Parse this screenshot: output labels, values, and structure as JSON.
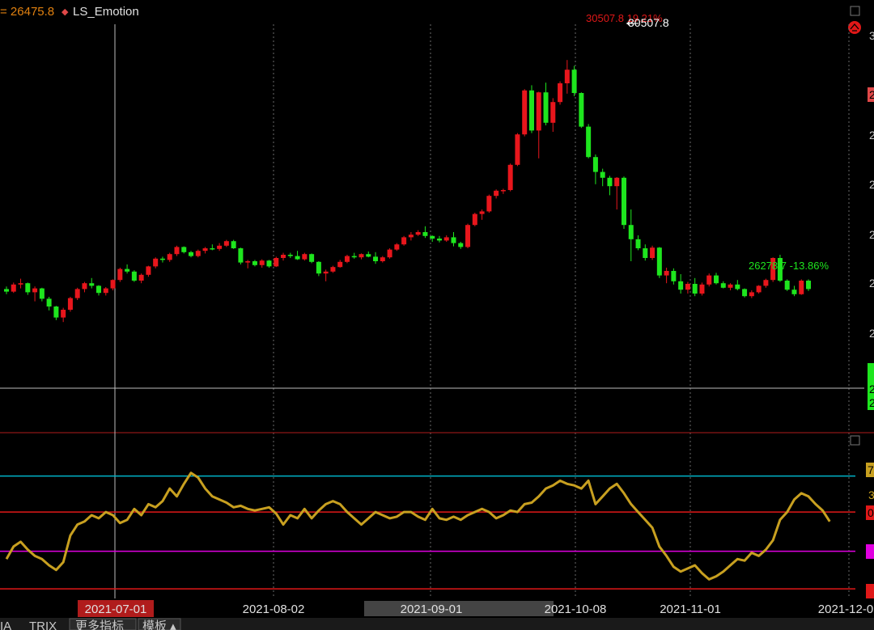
{
  "header": {
    "price_text": "= 26475.8",
    "indicator_marker": "◆",
    "indicator_name": "LS_Emotion"
  },
  "chart_data": [
    {
      "type": "candlestick",
      "y_range": [
        25500,
        31000
      ],
      "x_labels": [
        "2021-07-01",
        "2021-08-02",
        "2021-09-01",
        "2021-10-08",
        "2021-11-01",
        "2021-12-0"
      ],
      "max_annotation": "30507.8 19.21%",
      "max_pointer_label": "30507.8",
      "min_annotation": "26278.7 -13.86%",
      "right_axis_labels": [
        "3",
        "2",
        "2",
        "2",
        "2",
        "2",
        "2",
        "2",
        "2"
      ],
      "candles": [
        [
          26970,
          27010,
          26890,
          26930
        ],
        [
          26930,
          27070,
          26910,
          27040
        ],
        [
          27040,
          27130,
          26980,
          27060
        ],
        [
          27060,
          27070,
          26880,
          26920
        ],
        [
          26920,
          27010,
          26780,
          26980
        ],
        [
          26980,
          26990,
          26780,
          26820
        ],
        [
          26820,
          26850,
          26640,
          26700
        ],
        [
          26700,
          26710,
          26490,
          26530
        ],
        [
          26530,
          26680,
          26460,
          26650
        ],
        [
          26650,
          26850,
          26620,
          26830
        ],
        [
          26830,
          26990,
          26800,
          26970
        ],
        [
          26970,
          27080,
          26920,
          27060
        ],
        [
          27060,
          27140,
          26980,
          27020
        ],
        [
          27020,
          27030,
          26870,
          26910
        ],
        [
          26910,
          27000,
          26870,
          26980
        ],
        [
          26980,
          27120,
          26950,
          27110
        ],
        [
          27110,
          27300,
          27080,
          27280
        ],
        [
          27280,
          27350,
          27210,
          27240
        ],
        [
          27240,
          27260,
          27080,
          27100
        ],
        [
          27100,
          27210,
          27060,
          27190
        ],
        [
          27190,
          27330,
          27160,
          27320
        ],
        [
          27320,
          27460,
          27290,
          27440
        ],
        [
          27440,
          27470,
          27380,
          27420
        ],
        [
          27420,
          27530,
          27390,
          27510
        ],
        [
          27510,
          27640,
          27480,
          27620
        ],
        [
          27620,
          27630,
          27520,
          27540
        ],
        [
          27540,
          27560,
          27460,
          27480
        ],
        [
          27480,
          27580,
          27460,
          27560
        ],
        [
          27560,
          27620,
          27520,
          27600
        ],
        [
          27600,
          27660,
          27570,
          27590
        ],
        [
          27590,
          27680,
          27560,
          27640
        ],
        [
          27640,
          27730,
          27620,
          27710
        ],
        [
          27710,
          27730,
          27590,
          27600
        ],
        [
          27600,
          27610,
          27350,
          27380
        ],
        [
          27380,
          27420,
          27290,
          27400
        ],
        [
          27400,
          27420,
          27320,
          27340
        ],
        [
          27340,
          27430,
          27300,
          27410
        ],
        [
          27410,
          27420,
          27300,
          27320
        ],
        [
          27320,
          27470,
          27310,
          27450
        ],
        [
          27450,
          27530,
          27410,
          27500
        ],
        [
          27500,
          27530,
          27450,
          27480
        ],
        [
          27480,
          27560,
          27420,
          27430
        ],
        [
          27430,
          27530,
          27410,
          27510
        ],
        [
          27510,
          27520,
          27370,
          27390
        ],
        [
          27390,
          27400,
          27170,
          27210
        ],
        [
          27210,
          27270,
          27090,
          27240
        ],
        [
          27240,
          27330,
          27220,
          27310
        ],
        [
          27310,
          27420,
          27300,
          27390
        ],
        [
          27390,
          27500,
          27370,
          27480
        ],
        [
          27480,
          27530,
          27440,
          27460
        ],
        [
          27460,
          27520,
          27430,
          27510
        ],
        [
          27510,
          27550,
          27460,
          27470
        ],
        [
          27470,
          27540,
          27360,
          27400
        ],
        [
          27400,
          27480,
          27380,
          27460
        ],
        [
          27460,
          27600,
          27440,
          27580
        ],
        [
          27580,
          27680,
          27560,
          27660
        ],
        [
          27660,
          27790,
          27640,
          27770
        ],
        [
          27770,
          27850,
          27720,
          27810
        ],
        [
          27810,
          27880,
          27790,
          27850
        ],
        [
          27850,
          27940,
          27760,
          27790
        ],
        [
          27790,
          27800,
          27700,
          27750
        ],
        [
          27750,
          27790,
          27690,
          27720
        ],
        [
          27720,
          27800,
          27700,
          27770
        ],
        [
          27770,
          27850,
          27630,
          27680
        ],
        [
          27680,
          27700,
          27590,
          27620
        ],
        [
          27620,
          27980,
          27600,
          27960
        ],
        [
          27960,
          28150,
          27940,
          28130
        ],
        [
          28130,
          28200,
          28040,
          28170
        ],
        [
          28170,
          28430,
          28150,
          28410
        ],
        [
          28410,
          28510,
          28370,
          28490
        ],
        [
          28490,
          28520,
          28440,
          28500
        ],
        [
          28500,
          28910,
          28480,
          28890
        ],
        [
          28890,
          29380,
          28870,
          29360
        ],
        [
          29360,
          30060,
          29330,
          30040
        ],
        [
          30040,
          30120,
          29380,
          29420
        ],
        [
          29420,
          30020,
          28990,
          30010
        ],
        [
          30010,
          30160,
          29500,
          29540
        ],
        [
          29540,
          29920,
          29400,
          29860
        ],
        [
          29860,
          30180,
          29820,
          30150
        ],
        [
          30150,
          30510,
          29990,
          30360
        ],
        [
          30360,
          30420,
          29950,
          30000
        ],
        [
          30000,
          30010,
          29460,
          29480
        ],
        [
          29480,
          29520,
          28990,
          29010
        ],
        [
          29010,
          29050,
          28590,
          28780
        ],
        [
          28780,
          28830,
          28560,
          28690
        ],
        [
          28690,
          28720,
          28420,
          28560
        ],
        [
          28560,
          28700,
          28200,
          28690
        ],
        [
          28690,
          28710,
          27900,
          27960
        ],
        [
          27960,
          28200,
          27400,
          27740
        ],
        [
          27740,
          27800,
          27570,
          27600
        ],
        [
          27600,
          27660,
          27410,
          27450
        ],
        [
          27450,
          27640,
          27420,
          27610
        ],
        [
          27610,
          27620,
          27140,
          27180
        ],
        [
          27180,
          27300,
          27060,
          27250
        ],
        [
          27250,
          27290,
          27040,
          27090
        ],
        [
          27090,
          27200,
          26900,
          26960
        ],
        [
          26960,
          27080,
          26900,
          27050
        ],
        [
          27050,
          27140,
          26860,
          26900
        ],
        [
          26900,
          27070,
          26870,
          27040
        ],
        [
          27040,
          27210,
          27010,
          27180
        ],
        [
          27180,
          27220,
          27040,
          27060
        ],
        [
          27060,
          27090,
          26980,
          26990
        ],
        [
          26990,
          27060,
          26950,
          27040
        ],
        [
          27040,
          27110,
          26950,
          26970
        ],
        [
          26970,
          26980,
          26840,
          26860
        ],
        [
          26860,
          26950,
          26830,
          26920
        ],
        [
          26920,
          27030,
          26900,
          27020
        ],
        [
          27020,
          27130,
          26990,
          27110
        ],
        [
          27110,
          27460,
          27080,
          27450
        ],
        [
          27450,
          27500,
          27080,
          27100
        ],
        [
          27100,
          27120,
          26940,
          26960
        ],
        [
          26960,
          27020,
          26860,
          26890
        ],
        [
          26890,
          27120,
          26880,
          27100
        ],
        [
          27100,
          27120,
          26940,
          26970
        ]
      ]
    },
    {
      "type": "line",
      "name": "LS_Emotion",
      "y_range": [
        0,
        80
      ],
      "reference_lines": [
        {
          "value": 73,
          "color": "#00b4c8"
        },
        {
          "value": 50,
          "color": "#e01818"
        },
        {
          "value": 25,
          "color": "#e000e0"
        },
        {
          "value": 1,
          "color": "#e01818"
        }
      ],
      "right_axis_labels": [
        "7",
        "3",
        "0"
      ],
      "values": [
        20,
        28,
        31,
        26,
        22,
        20,
        16,
        13,
        18,
        35,
        42,
        44,
        48,
        46,
        50,
        48,
        43,
        45,
        52,
        48,
        55,
        53,
        57,
        65,
        60,
        68,
        75,
        72,
        65,
        60,
        58,
        56,
        53,
        54,
        52,
        51,
        52,
        53,
        49,
        42,
        48,
        46,
        52,
        46,
        51,
        55,
        57,
        55,
        50,
        46,
        42,
        46,
        50,
        48,
        46,
        47,
        50,
        50,
        47,
        45,
        52,
        46,
        45,
        47,
        45,
        48,
        50,
        52,
        50,
        46,
        48,
        51,
        50,
        55,
        56,
        60,
        65,
        67,
        70,
        68,
        67,
        65,
        70,
        55,
        60,
        65,
        68,
        62,
        55,
        50,
        45,
        40,
        28,
        22,
        15,
        12,
        14,
        16,
        11,
        7,
        9,
        12,
        16,
        20,
        19,
        24,
        22,
        26,
        32,
        45,
        50,
        58,
        62,
        60,
        55,
        51,
        44
      ]
    }
  ],
  "bottom_tabs": {
    "tab1": "IA",
    "tab2": "TRIX",
    "tab3": "更多指标",
    "tab4": "模板 ▴"
  },
  "colors": {
    "up": "#e8161c",
    "down": "#1ee61e",
    "line": "#c8a020",
    "header_price": "#e08010",
    "header_name": "#e0e0e0",
    "marker": "#e04848"
  }
}
